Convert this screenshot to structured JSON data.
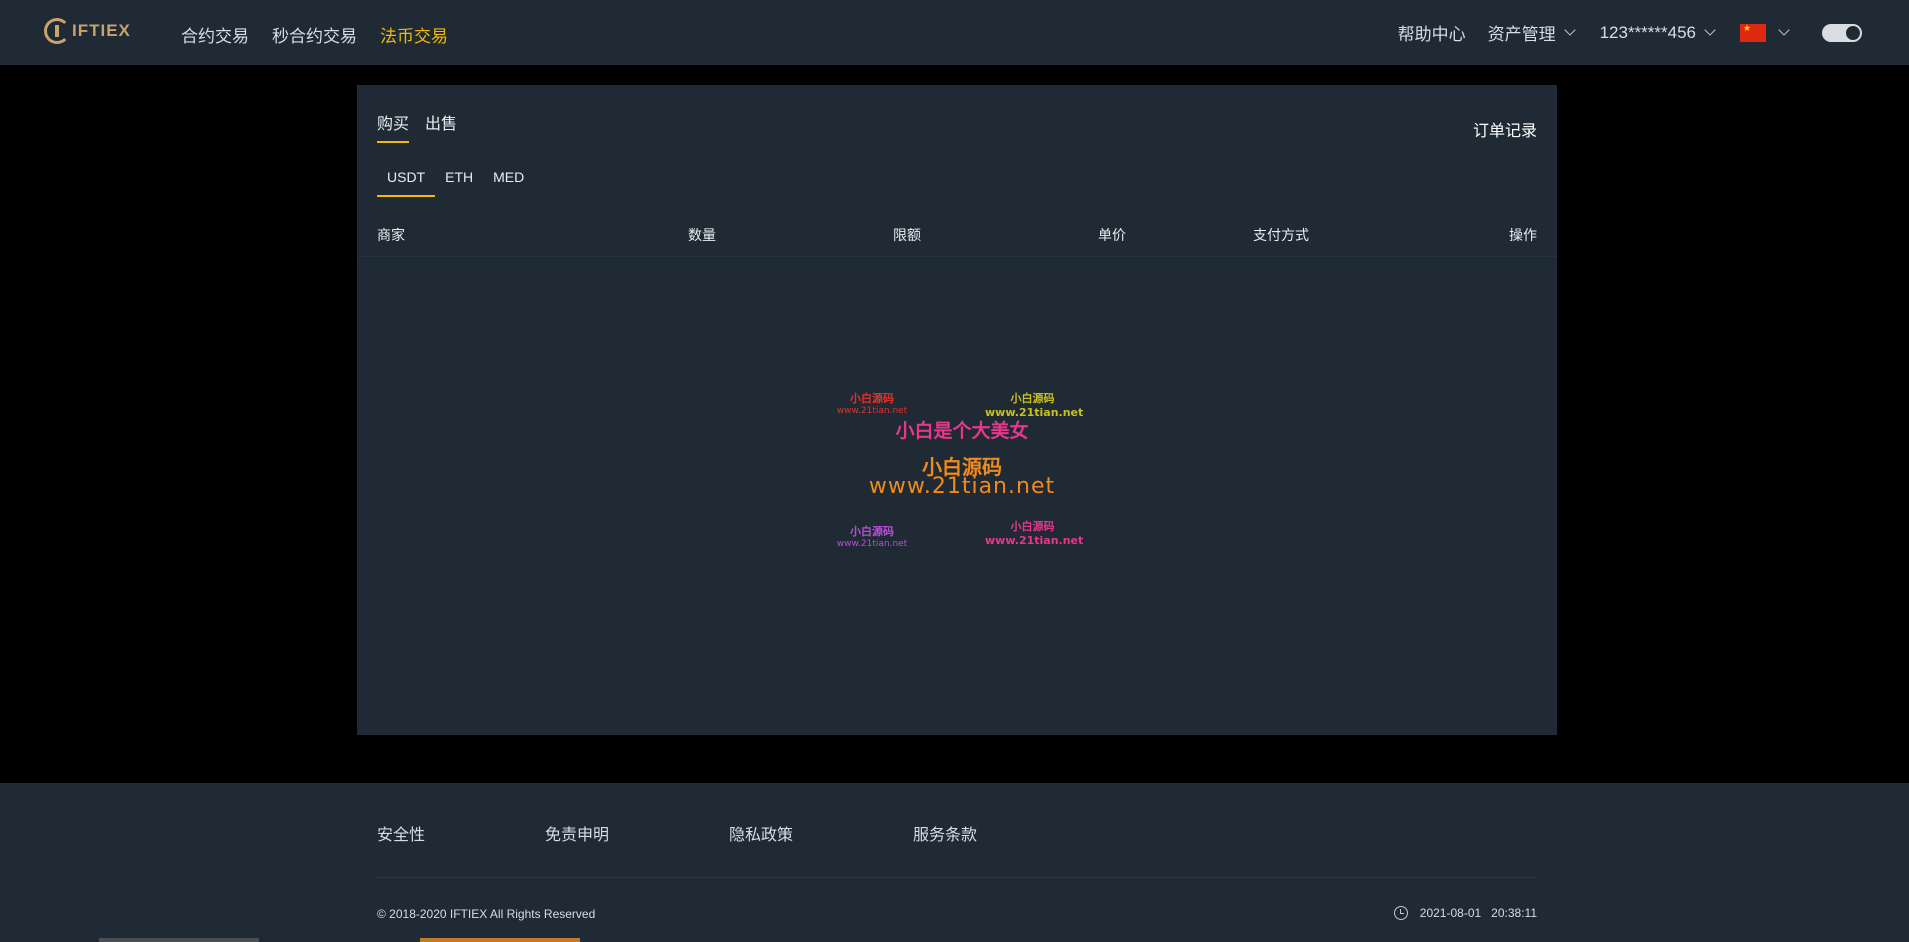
{
  "header": {
    "logo_text": "IFTIEX",
    "nav": [
      {
        "label": "合约交易",
        "active": false
      },
      {
        "label": "秒合约交易",
        "active": false
      },
      {
        "label": "法币交易",
        "active": true
      }
    ],
    "help": "帮助中心",
    "assets": "资产管理",
    "user": "123******456",
    "language_flag": "china-flag-icon",
    "theme_toggle": "dark"
  },
  "panel": {
    "trade_tabs": [
      {
        "label": "购买",
        "active": true
      },
      {
        "label": "出售",
        "active": false
      }
    ],
    "order_record": "订单记录",
    "coins": [
      {
        "label": "USDT",
        "active": true
      },
      {
        "label": "ETH",
        "active": false
      },
      {
        "label": "MED",
        "active": false
      }
    ],
    "columns": [
      "商家",
      "数量",
      "限额",
      "单价",
      "支付方式",
      "操作"
    ],
    "watermark": {
      "tl_zh": "小白源码",
      "tl_url": "www.21tian.net",
      "tr_zh": "小白源码",
      "tr_url": "www.21tian.net",
      "slogan": "小白是个大美女",
      "center_zh": "小白源码",
      "center_url": "www.21tian.net",
      "bl_zh": "小白源码",
      "bl_url": "www.21tian.net",
      "br_zh": "小白源码",
      "br_url": "www.21tian.net"
    }
  },
  "footer": {
    "links": [
      "安全性",
      "免责申明",
      "隐私政策",
      "服务条款"
    ],
    "copyright": "© 2018-2020 IFTIEX All Rights Reserved",
    "date": "2021-08-01",
    "time": "20:38:11"
  },
  "colors": {
    "header_bg": "#1f2a35",
    "page_bg": "#000000",
    "accent": "#f0b90b"
  }
}
